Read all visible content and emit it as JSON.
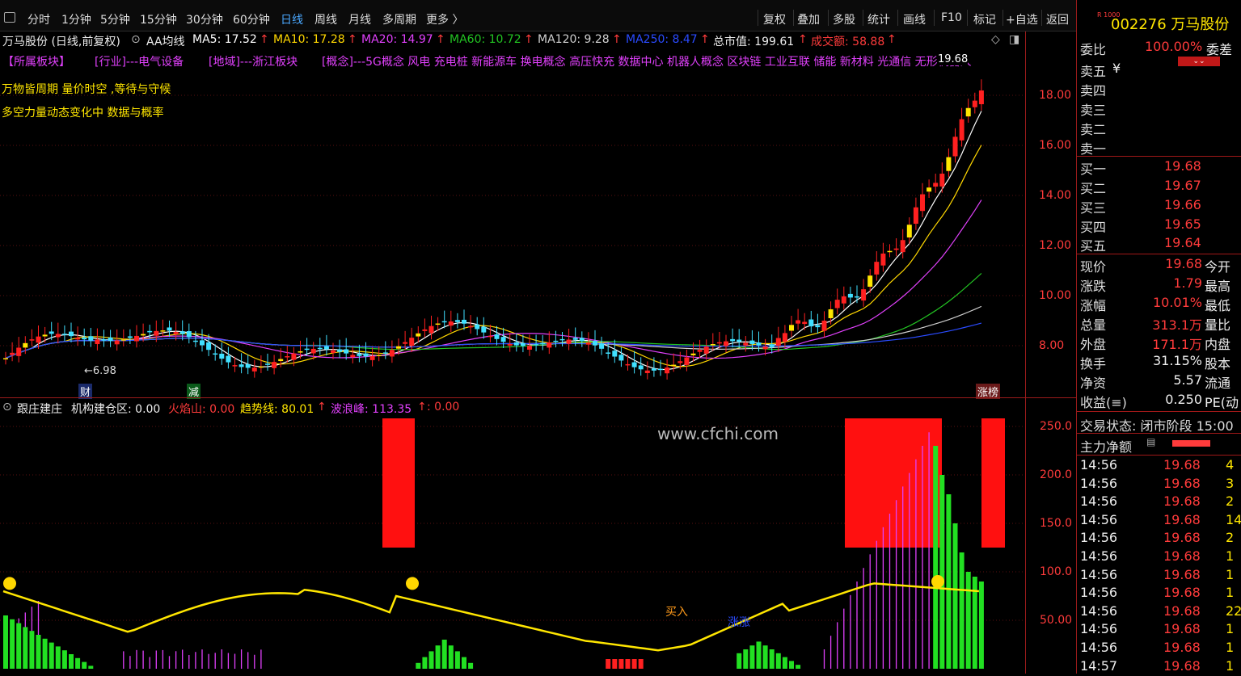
{
  "toolbar": {
    "periods": [
      "分时",
      "1分钟",
      "5分钟",
      "15分钟",
      "30分钟",
      "60分钟",
      "日线",
      "周线",
      "月线",
      "多周期",
      "更多 〉"
    ],
    "active_period": "日线",
    "tools": [
      "复权",
      "叠加",
      "多股",
      "统计",
      "画线",
      "F10",
      "标记",
      "+自选",
      "返回"
    ]
  },
  "stock": {
    "name_line": "万马股份 (日线,前复权)",
    "code_name": "002276 万马股份",
    "badge": "R 1000"
  },
  "ma": {
    "indicator_name": "AA均线",
    "ma5": "MA5: 17.52",
    "ma10": "MA10: 17.28",
    "ma20": "MA20: 14.97",
    "ma60": "MA60: 10.72",
    "ma120": "MA120: 9.28",
    "ma250": "MA250: 8.47",
    "market_cap": "总市值: 199.61",
    "turnover": "成交额: 58.88",
    "arrow": "↑"
  },
  "colors": {
    "ma5": "#ffffff",
    "ma10": "#ffd700",
    "ma20": "#e040fb",
    "ma60": "#22c322",
    "ma120": "#cfcfcf",
    "ma250": "#2a4bff",
    "up": "#ff2020",
    "down": "#40e0ff",
    "yellow_candle": "#ffe600"
  },
  "boards": {
    "sector": "【所属板块】",
    "industry": "[行业]---电气设备",
    "region": "[地域]---浙江板块",
    "concepts": "[概念]---5G概念 风电 充电桩 新能源车 换电概念 高压快充 数据中心 机器人概念 区块链 工业互联 储能 新材料 光通信 无形机器人"
  },
  "notes": {
    "line1": "万物皆周期  量价时空 ,等待与守候",
    "line2": "多空力量动态变化中 数据与概率"
  },
  "main_chart": {
    "y_ticks": [
      "18.00",
      "16.00",
      "14.00",
      "12.00",
      "10.00",
      "8.00"
    ],
    "high_label": "19.68",
    "low_label": "6.98",
    "markers": {
      "cai": "财",
      "jian": "减",
      "zhangting": "涨榜"
    }
  },
  "sub_chart": {
    "title": "跟庄建庄",
    "jgjc": "机构建仓区: 0.00",
    "hys": "火焰山: 0.00",
    "qsx": "趋势线: 80.01",
    "blf": "波浪峰: 113.35",
    "extra": ": 0.00",
    "arrow": "↑",
    "y_ticks": [
      "250.0",
      "200.0",
      "150.0",
      "100.0",
      "50.00"
    ],
    "watermark": "www.cfchi.com",
    "buy_label": "买入",
    "rise_label": "涨涨"
  },
  "quote": {
    "weibi_label": "委比",
    "weibi_value": "100.00%",
    "weicha_label": "委差",
    "sell": [
      {
        "label": "卖五",
        "price": "¥"
      },
      {
        "label": "卖四",
        "price": ""
      },
      {
        "label": "卖三",
        "price": ""
      },
      {
        "label": "卖二",
        "price": ""
      },
      {
        "label": "卖一",
        "price": ""
      }
    ],
    "buy": [
      {
        "label": "买一",
        "price": "19.68"
      },
      {
        "label": "买二",
        "price": "19.67"
      },
      {
        "label": "买三",
        "price": "19.66"
      },
      {
        "label": "买四",
        "price": "19.65"
      },
      {
        "label": "买五",
        "price": "19.64"
      }
    ],
    "stats": [
      {
        "label": "现价",
        "value": "19.68",
        "label2": "今开"
      },
      {
        "label": "涨跌",
        "value": "1.79",
        "label2": "最高"
      },
      {
        "label": "涨幅",
        "value": "10.01%",
        "label2": "最低"
      },
      {
        "label": "总量",
        "value": "313.1万",
        "label2": "量比"
      },
      {
        "label": "外盘",
        "value": "171.1万",
        "label2": "内盘"
      },
      {
        "label": "换手",
        "value": "31.15%",
        "label2": "股本"
      },
      {
        "label": "净资",
        "value": "5.57",
        "label2": "流通"
      },
      {
        "label": "收益(≡)",
        "value": "0.250",
        "label2": "PE(动"
      }
    ],
    "trade_state": "交易状态: 闭市阶段 15:00",
    "main_flow": "主力净额",
    "ticks": [
      {
        "time": "14:56",
        "price": "19.68",
        "vol": "4"
      },
      {
        "time": "14:56",
        "price": "19.68",
        "vol": "3"
      },
      {
        "time": "14:56",
        "price": "19.68",
        "vol": "2"
      },
      {
        "time": "14:56",
        "price": "19.68",
        "vol": "14"
      },
      {
        "time": "14:56",
        "price": "19.68",
        "vol": "2"
      },
      {
        "time": "14:56",
        "price": "19.68",
        "vol": "1"
      },
      {
        "time": "14:56",
        "price": "19.68",
        "vol": "1"
      },
      {
        "time": "14:56",
        "price": "19.68",
        "vol": "1"
      },
      {
        "time": "14:56",
        "price": "19.68",
        "vol": "22"
      },
      {
        "time": "14:56",
        "price": "19.68",
        "vol": "1"
      },
      {
        "time": "14:56",
        "price": "19.68",
        "vol": "1"
      },
      {
        "time": "14:57",
        "price": "19.68",
        "vol": "1"
      }
    ]
  }
}
